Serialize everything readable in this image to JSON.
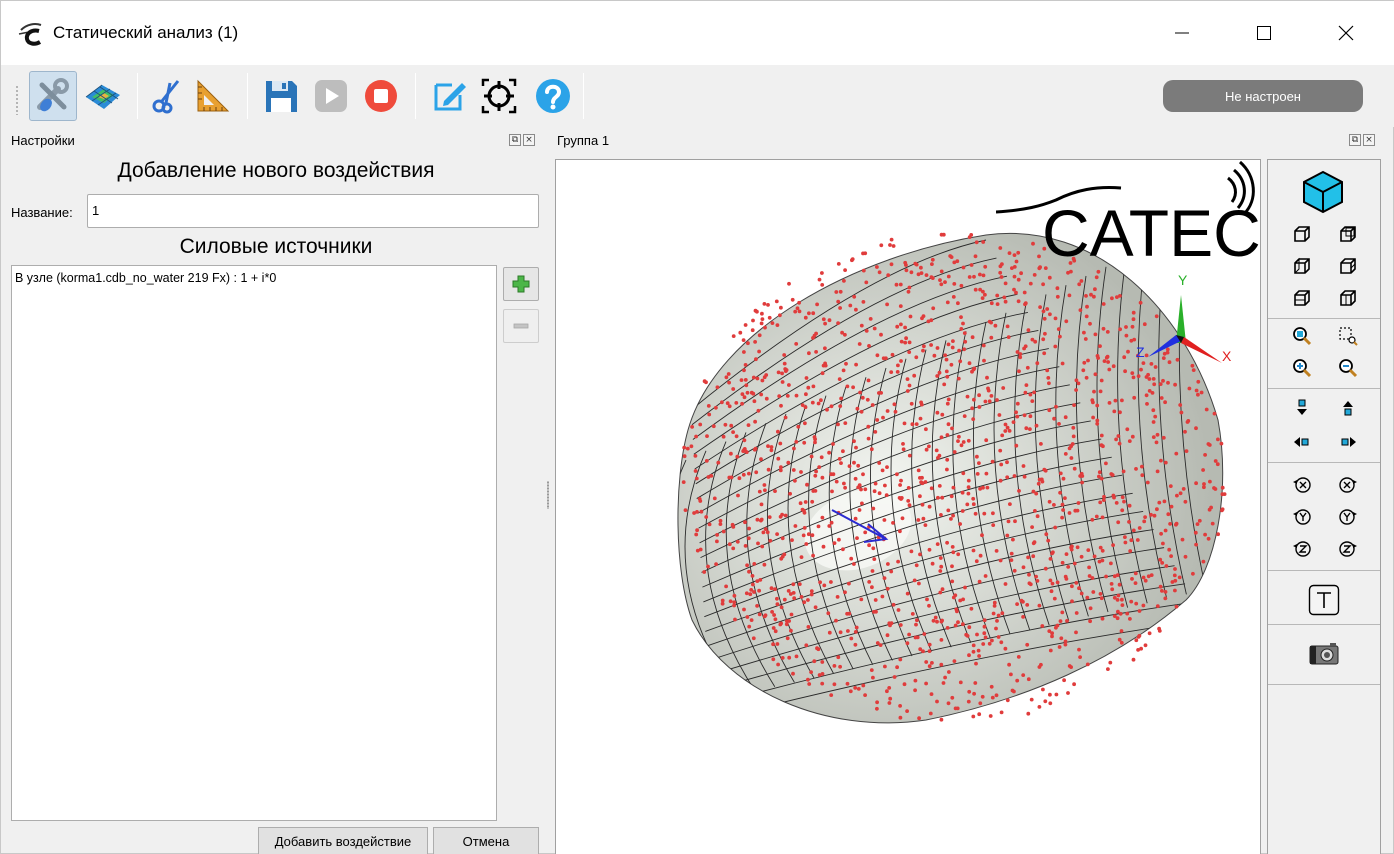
{
  "window": {
    "title": "Статический анализ (1)",
    "status": "Не настроен"
  },
  "toolbar": {
    "items": [
      {
        "name": "settings-tools-icon",
        "active": true
      },
      {
        "name": "mesh-surface-icon"
      },
      {
        "name": "cut-icon"
      },
      {
        "name": "triangle-ruler-icon"
      },
      {
        "name": "save-icon"
      },
      {
        "name": "play-icon"
      },
      {
        "name": "stop-icon"
      },
      {
        "name": "edit-icon"
      },
      {
        "name": "target-icon"
      },
      {
        "name": "help-icon"
      }
    ]
  },
  "settings_panel": {
    "title": "Настройки",
    "heading": "Добавление нового воздействия",
    "name_label": "Название:",
    "name_value": "1",
    "sources_heading": "Силовые источники",
    "sources": [
      "В узле (korma1.cdb_no_water 219 Fx) : 1 + i*0"
    ],
    "add_button": "Добавить воздействие",
    "cancel_button": "Отмена"
  },
  "view_panel": {
    "title": "Группа 1",
    "logo_text": "CATEC",
    "axes": {
      "x": "X",
      "y": "Y",
      "z": "Z"
    }
  },
  "colors": {
    "node_red": "#e03c3c",
    "axis_x": "#e02020",
    "axis_y": "#2ab02a",
    "axis_z": "#2030e0",
    "status_bg": "#7b7b7b",
    "surface": "#c8ccc6"
  }
}
